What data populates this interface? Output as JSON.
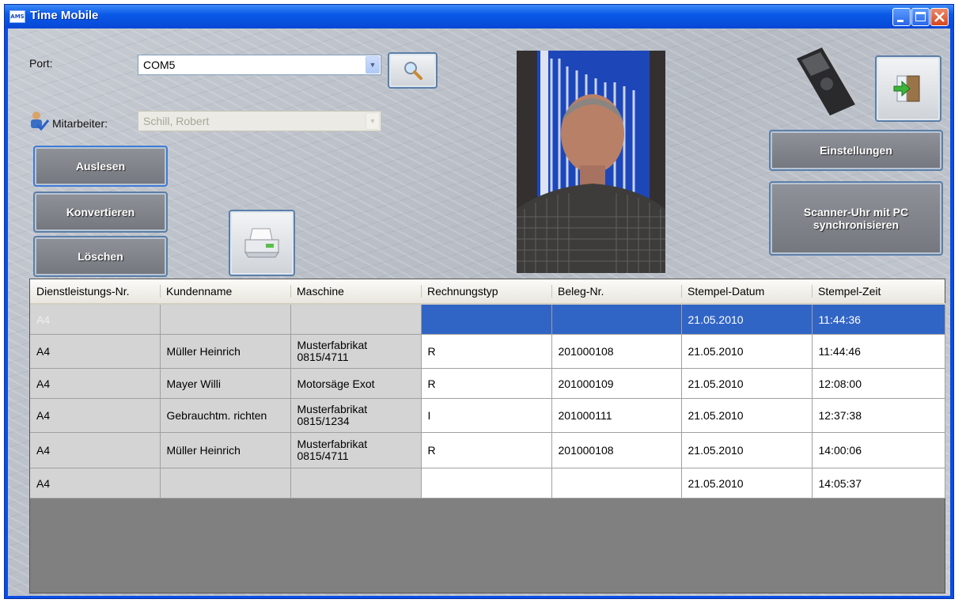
{
  "window": {
    "title": "Time Mobile",
    "app_icon_text": "AMS"
  },
  "port": {
    "label": "Port:",
    "value": "COM5"
  },
  "mitarbeiter": {
    "label": "Mitarbeiter:",
    "value": "Schill, Robert"
  },
  "buttons": {
    "auslesen": "Auslesen",
    "konvertieren": "Konvertieren",
    "loeschen": "Löschen",
    "einstellungen": "Einstellungen",
    "sync_line1": "Scanner-Uhr mit PC",
    "sync_line2": "synchronisieren"
  },
  "icons": {
    "search": "magnifier-icon",
    "print": "printer-icon",
    "exit": "exit-door-icon",
    "scanner": "scanner-device-icon",
    "user": "user-check-icon",
    "photo": "employee-photo"
  },
  "colors": {
    "titlebar": "#0a5ae8",
    "selection": "#3165c5",
    "button": "#7f8289"
  },
  "table": {
    "columns": [
      "Dienstleistungs-Nr.",
      "Kundenname",
      "Maschine",
      "Rechnungstyp",
      "Beleg-Nr.",
      "Stempel-Datum",
      "Stempel-Zeit"
    ],
    "rows": [
      {
        "nr": "A4",
        "kunde": "",
        "maschine": "",
        "typ": "",
        "beleg": "",
        "datum": "21.05.2010",
        "zeit": "11:44:36"
      },
      {
        "nr": "A4",
        "kunde": "Müller Heinrich",
        "maschine_l1": "Musterfabrikat",
        "maschine_l2": "0815/4711",
        "typ": "R",
        "beleg": "201000108",
        "datum": "21.05.2010",
        "zeit": "11:44:46"
      },
      {
        "nr": "A4",
        "kunde": "Mayer Willi",
        "maschine": "Motorsäge Exot",
        "typ": "R",
        "beleg": "201000109",
        "datum": "21.05.2010",
        "zeit": "12:08:00"
      },
      {
        "nr": "A4",
        "kunde": "Gebrauchtm. richten",
        "maschine_l1": "Musterfabrikat",
        "maschine_l2": "0815/1234",
        "typ": "I",
        "beleg": "201000111",
        "datum": "21.05.2010",
        "zeit": "12:37:38"
      },
      {
        "nr": "A4",
        "kunde": "Müller Heinrich",
        "maschine_l1": "Musterfabrikat",
        "maschine_l2": "0815/4711",
        "typ": "R",
        "beleg": "201000108",
        "datum": "21.05.2010",
        "zeit": "14:00:06"
      },
      {
        "nr": "A4",
        "kunde": "",
        "maschine": "",
        "typ": "",
        "beleg": "",
        "datum": "21.05.2010",
        "zeit": "14:05:37"
      }
    ]
  }
}
